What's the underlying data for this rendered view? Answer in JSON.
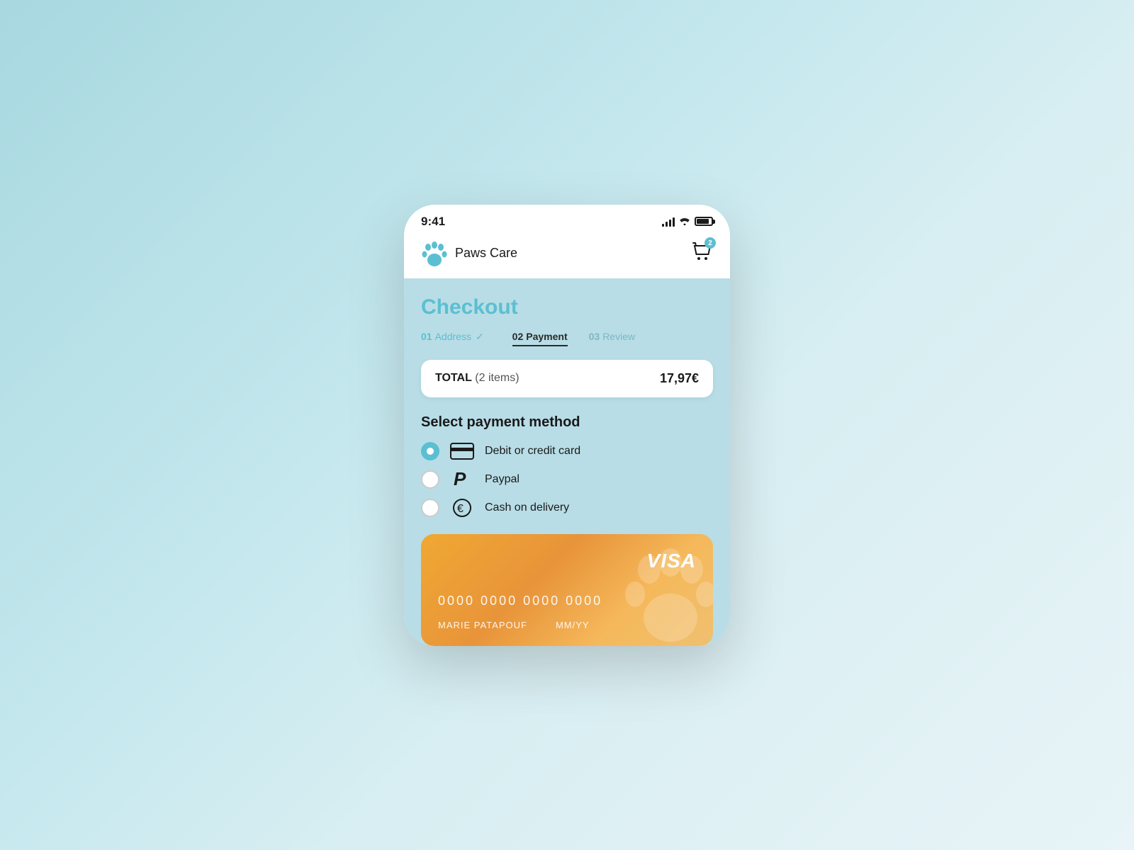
{
  "app": {
    "time": "9:41",
    "name": "Paws Care",
    "cart_count": "2"
  },
  "header": {
    "title": "Checkout"
  },
  "steps": [
    {
      "number": "01",
      "label": "Address",
      "state": "completed"
    },
    {
      "number": "02",
      "label": "Payment",
      "state": "active"
    },
    {
      "number": "03",
      "label": "Review",
      "state": "inactive"
    }
  ],
  "total": {
    "label": "TOTAL",
    "items": "(2 items)",
    "amount": "17,97€"
  },
  "payment": {
    "section_title": "Select payment method",
    "options": [
      {
        "id": "card",
        "label": "Debit or credit card",
        "selected": true
      },
      {
        "id": "paypal",
        "label": "Paypal",
        "selected": false
      },
      {
        "id": "cash",
        "label": "Cash on delivery",
        "selected": false
      }
    ]
  },
  "card": {
    "brand": "VISA",
    "number": "0000 0000 0000 0000",
    "holder": "MARIE PATAPOUF",
    "expiry": "MM/YY"
  }
}
